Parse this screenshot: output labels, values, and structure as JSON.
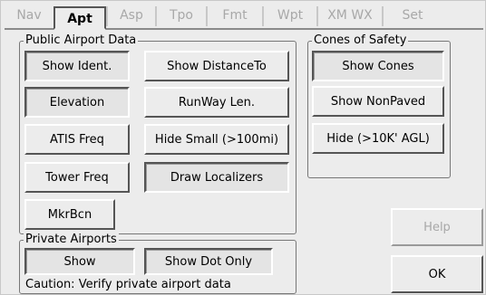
{
  "tabs": [
    {
      "label": "Nav",
      "active": false
    },
    {
      "label": "Apt",
      "active": true
    },
    {
      "label": "Asp",
      "active": false
    },
    {
      "label": "Tpo",
      "active": false
    },
    {
      "label": "Fmt",
      "active": false
    },
    {
      "label": "Wpt",
      "active": false
    },
    {
      "label": "XM WX",
      "active": false
    },
    {
      "label": "Set",
      "active": false
    }
  ],
  "public_group": {
    "title": "Public Airport Data",
    "show_ident": "Show Ident.",
    "show_distance": "Show DistanceTo",
    "elevation": "Elevation",
    "runway_len": "RunWay Len.",
    "atis_freq": "ATIS Freq",
    "hide_small": "Hide Small (>100mi)",
    "tower_freq": "Tower Freq",
    "draw_localizers": "Draw Localizers",
    "mkr_bcn": "MkrBcn"
  },
  "cones_group": {
    "title": "Cones of Safety",
    "show_cones": "Show Cones",
    "show_nonpaved": "Show NonPaved",
    "hide_agl": "Hide (>10K' AGL)"
  },
  "private_group": {
    "title": "Private Airports",
    "show": "Show",
    "show_dot_only": "Show Dot Only",
    "caution": "Caution: Verify private airport data"
  },
  "help_label": "Help",
  "ok_label": "OK"
}
